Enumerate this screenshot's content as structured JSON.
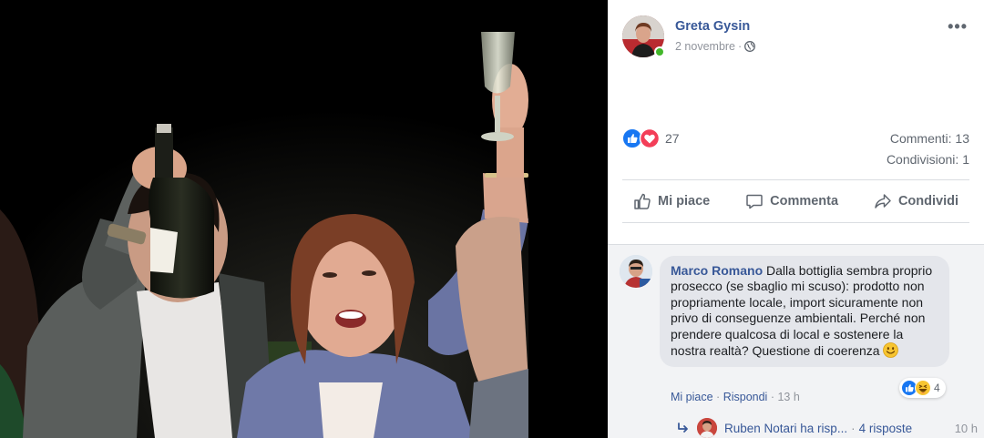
{
  "post": {
    "author": "Greta Gysin",
    "date": "2 novembre",
    "date_separator": "·",
    "privacy_icon": "globe-icon",
    "more_label": "•••"
  },
  "stats": {
    "reactions_count": "27",
    "comments": "Commenti: 13",
    "shares": "Condivisioni: 1",
    "reaction_icons": [
      "like-icon",
      "love-icon"
    ]
  },
  "actions": {
    "like": "Mi piace",
    "comment": "Commenta",
    "share": "Condividi"
  },
  "comment": {
    "author": "Marco Romano",
    "text": "Dalla bottiglia sembra proprio prosecco (se sbaglio mi scuso): prodotto non propriamente locale, import sicuramente non privo di conseguenze ambientali. Perché non prendere qualcosa di local e sostenere la nostra realtà? Questione di coerenza",
    "emoji_icon": "smiley-icon",
    "reactions_count": "4",
    "reaction_icons": [
      "like-icon",
      "haha-icon"
    ],
    "like_label": "Mi piace",
    "reply_label": "Rispondi",
    "time": "13 h",
    "separator": "·"
  },
  "replies": {
    "preview": "Ruben Notari ha risp...",
    "separator": "·",
    "count": "4 risposte",
    "time": "10 h"
  },
  "colors": {
    "link_blue": "#385898",
    "muted": "#90949c",
    "online_green": "#42b72a",
    "like_blue": "#1877f2",
    "love_red": "#f33e58",
    "comment_bg": "#f2f3f5"
  }
}
